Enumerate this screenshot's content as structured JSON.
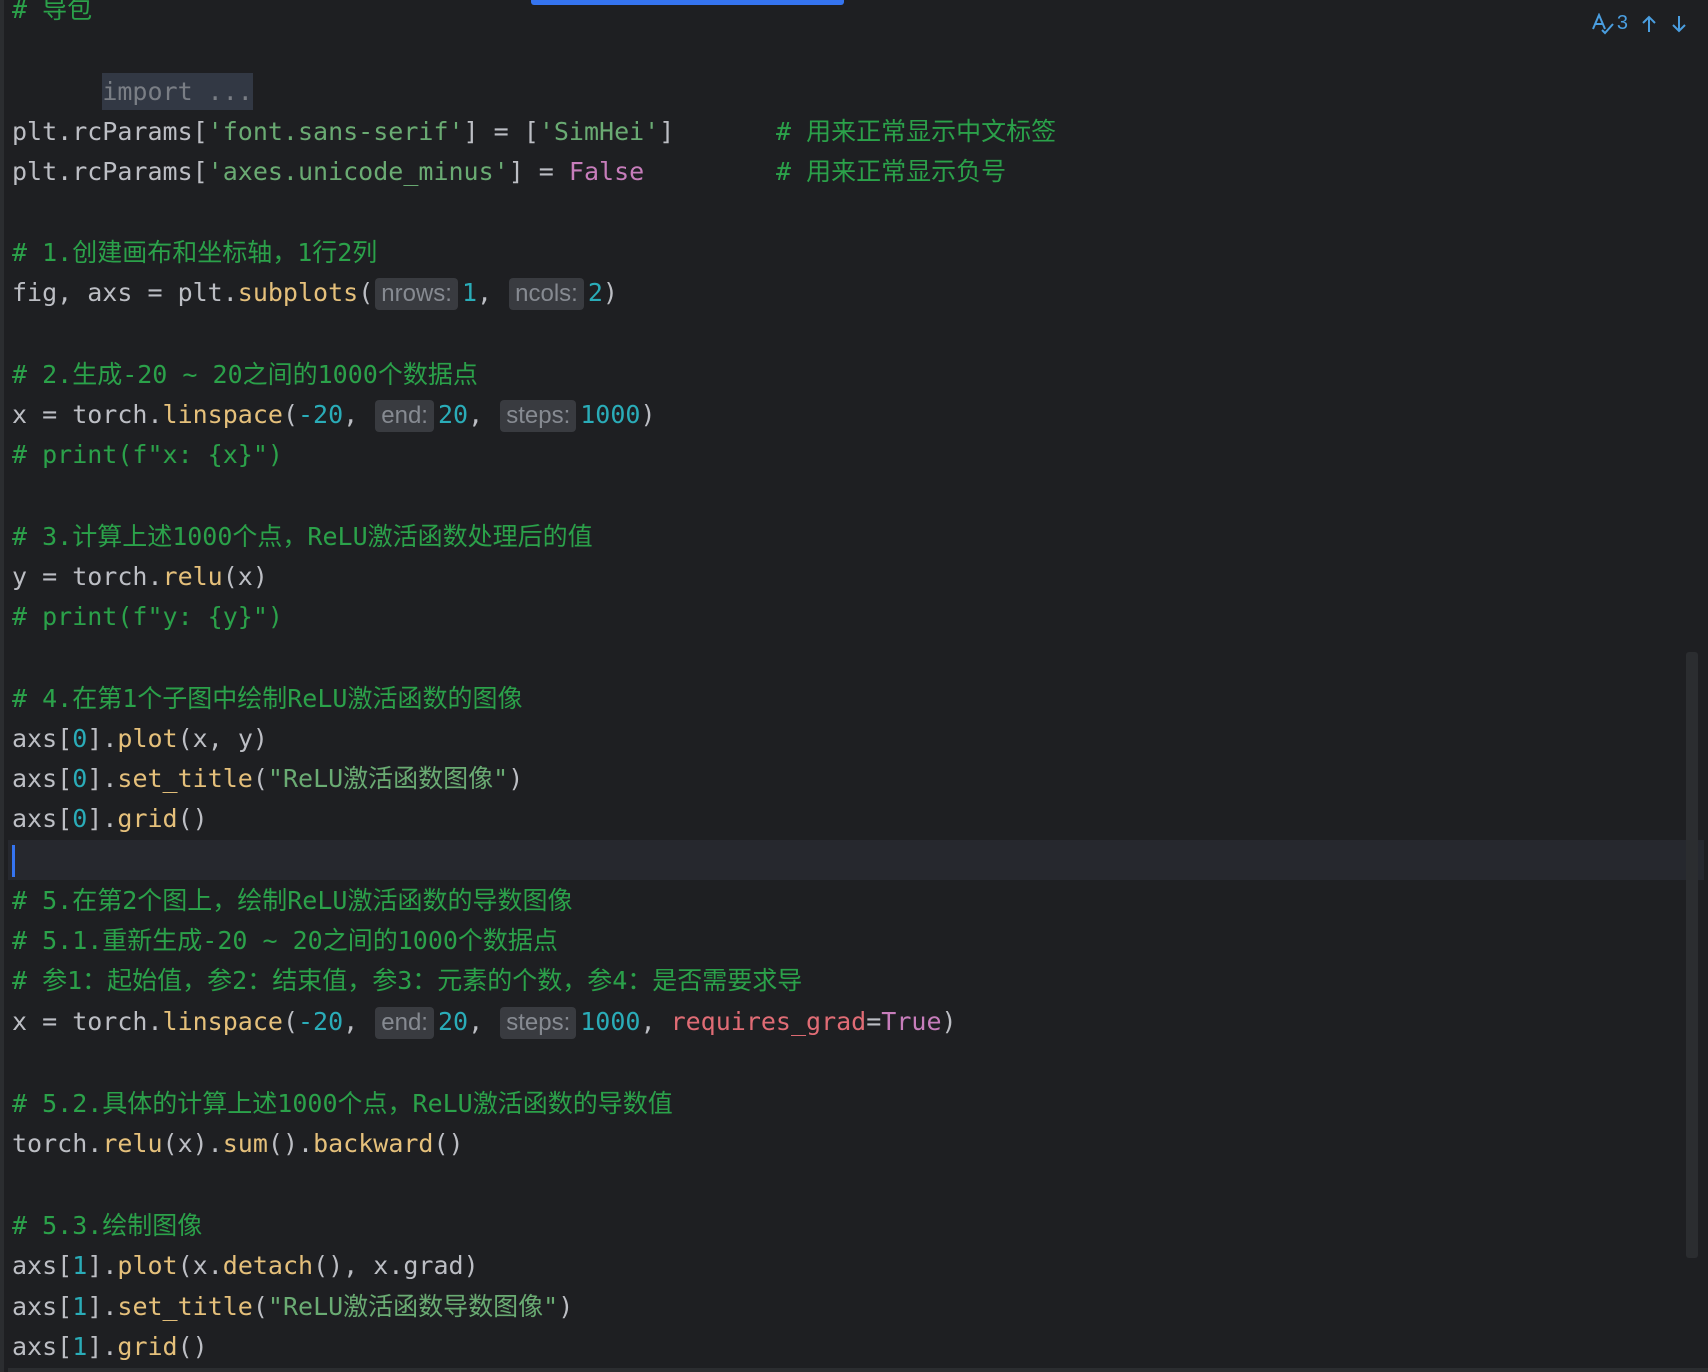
{
  "toolbar": {
    "inspection_count": "3"
  },
  "lines": {
    "l0": "# 导包",
    "l1_fold": "import ...",
    "l3": {
      "prefix": "plt.rcParams[",
      "key": "'font.sans-serif'",
      "mid": "] = [",
      "val": "'SimHei'",
      "end": "]",
      "comment": "# 用来正常显示中文标签"
    },
    "l4": {
      "prefix": "plt.rcParams[",
      "key": "'axes.unicode_minus'",
      "mid": "] = ",
      "val": "False",
      "comment": "# 用来正常显示负号"
    },
    "l6": "# 1.创建画布和坐标轴，1行2列",
    "l7": {
      "a": "fig, axs = plt.",
      "fn": "subplots",
      "b": "(",
      "hint1": "nrows:",
      "n1": "1",
      "c": ", ",
      "hint2": "ncols:",
      "n2": "2",
      "d": ")"
    },
    "l9": "# 2.生成-20 ~ 20之间的1000个数据点",
    "l10": {
      "a": "x = torch.",
      "fn": "linspace",
      "b": "(",
      "n0": "-20",
      "c": ", ",
      "hint1": "end:",
      "n1": "20",
      "d": ", ",
      "hint2": "steps:",
      "n2": "1000",
      "e": ")"
    },
    "l11": "# print(f\"x: {x}\")",
    "l13": "# 3.计算上述1000个点，ReLU激活函数处理后的值",
    "l14": {
      "a": "y = torch.",
      "fn": "relu",
      "b": "(x)"
    },
    "l15": "# print(f\"y: {y}\")",
    "l17": "# 4.在第1个子图中绘制ReLU激活函数的图像",
    "l18": {
      "a": "axs[",
      "idx": "0",
      "b": "].",
      "fn": "plot",
      "c": "(x, y)"
    },
    "l19": {
      "a": "axs[",
      "idx": "0",
      "b": "].",
      "fn": "set_title",
      "c": "(",
      "str": "\"ReLU激活函数图像\"",
      "d": ")"
    },
    "l20": {
      "a": "axs[",
      "idx": "0",
      "b": "].",
      "fn": "grid",
      "c": "()"
    },
    "l22": "# 5.在第2个图上，绘制ReLU激活函数的导数图像",
    "l23": "# 5.1.重新生成-20 ~ 20之间的1000个数据点",
    "l24": "# 参1：起始值，参2：结束值，参3：元素的个数，参4：是否需要求导",
    "l25": {
      "a": "x = torch.",
      "fn": "linspace",
      "b": "(",
      "n0": "-20",
      "c": ", ",
      "hint1": "end:",
      "n1": "20",
      "d": ", ",
      "hint2": "steps:",
      "n2": "1000",
      "e": ", ",
      "param": "requires_grad",
      "eq": "=",
      "kw": "True",
      "f": ")"
    },
    "l27": "# 5.2.具体的计算上述1000个点，ReLU激活函数的导数值",
    "l28": {
      "a": "torch.",
      "fn1": "relu",
      "b": "(x).",
      "fn2": "sum",
      "c": "().",
      "fn3": "backward",
      "d": "()"
    },
    "l30": "# 5.3.绘制图像",
    "l31": {
      "a": "axs[",
      "idx": "1",
      "b": "].",
      "fn": "plot",
      "c": "(x.",
      "fn2": "detach",
      "d": "(), x.grad)"
    },
    "l32": {
      "a": "axs[",
      "idx": "1",
      "b": "].",
      "fn": "set_title",
      "c": "(",
      "str": "\"ReLU激活函数导数图像\"",
      "d": ")"
    },
    "l33": {
      "a": "axs[",
      "idx": "1",
      "b": "].",
      "fn": "grid",
      "c": "()"
    }
  }
}
